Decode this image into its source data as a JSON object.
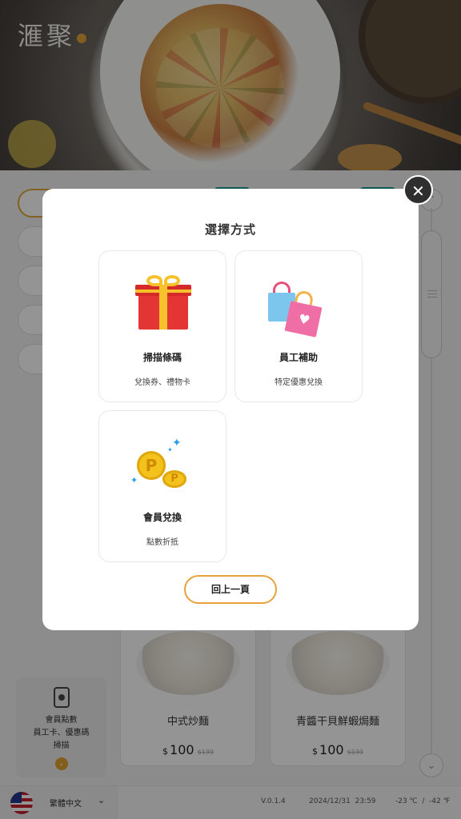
{
  "brand": {
    "logo_text": "滙聚"
  },
  "products": [
    {
      "name": "中式炒麵",
      "currency": "$",
      "price": "100",
      "old_price": "$139"
    },
    {
      "name": "青醬干貝鮮蝦焗麵",
      "currency": "$",
      "price": "100",
      "old_price": "$139"
    }
  ],
  "side_card": {
    "icon": "phone-icon",
    "line1": "會員點數",
    "line2": "員工卡、優惠碼",
    "line3": "掃描"
  },
  "status_bar": {
    "language": "繁體中文",
    "version": "V.0.1.4",
    "datetime": "2024/12/31  23:59",
    "temperature": "-23 ℃  /  -42 ℉"
  },
  "modal": {
    "title": "選擇方式",
    "close_icon": "close-icon",
    "options": [
      {
        "label": "掃描條碼",
        "desc": "兌換券、禮物卡",
        "icon": "gift-icon"
      },
      {
        "label": "員工補助",
        "desc": "特定優惠兌換",
        "icon": "shopping-bags-icon"
      },
      {
        "label": "會員兌換",
        "desc": "點數折抵",
        "icon": "points-coins-icon"
      }
    ],
    "back_label": "回上一頁"
  },
  "colors": {
    "accent": "#e9a13a",
    "overlay": "rgba(0,0,0,0.42)",
    "teal": "#1b9a8a"
  }
}
